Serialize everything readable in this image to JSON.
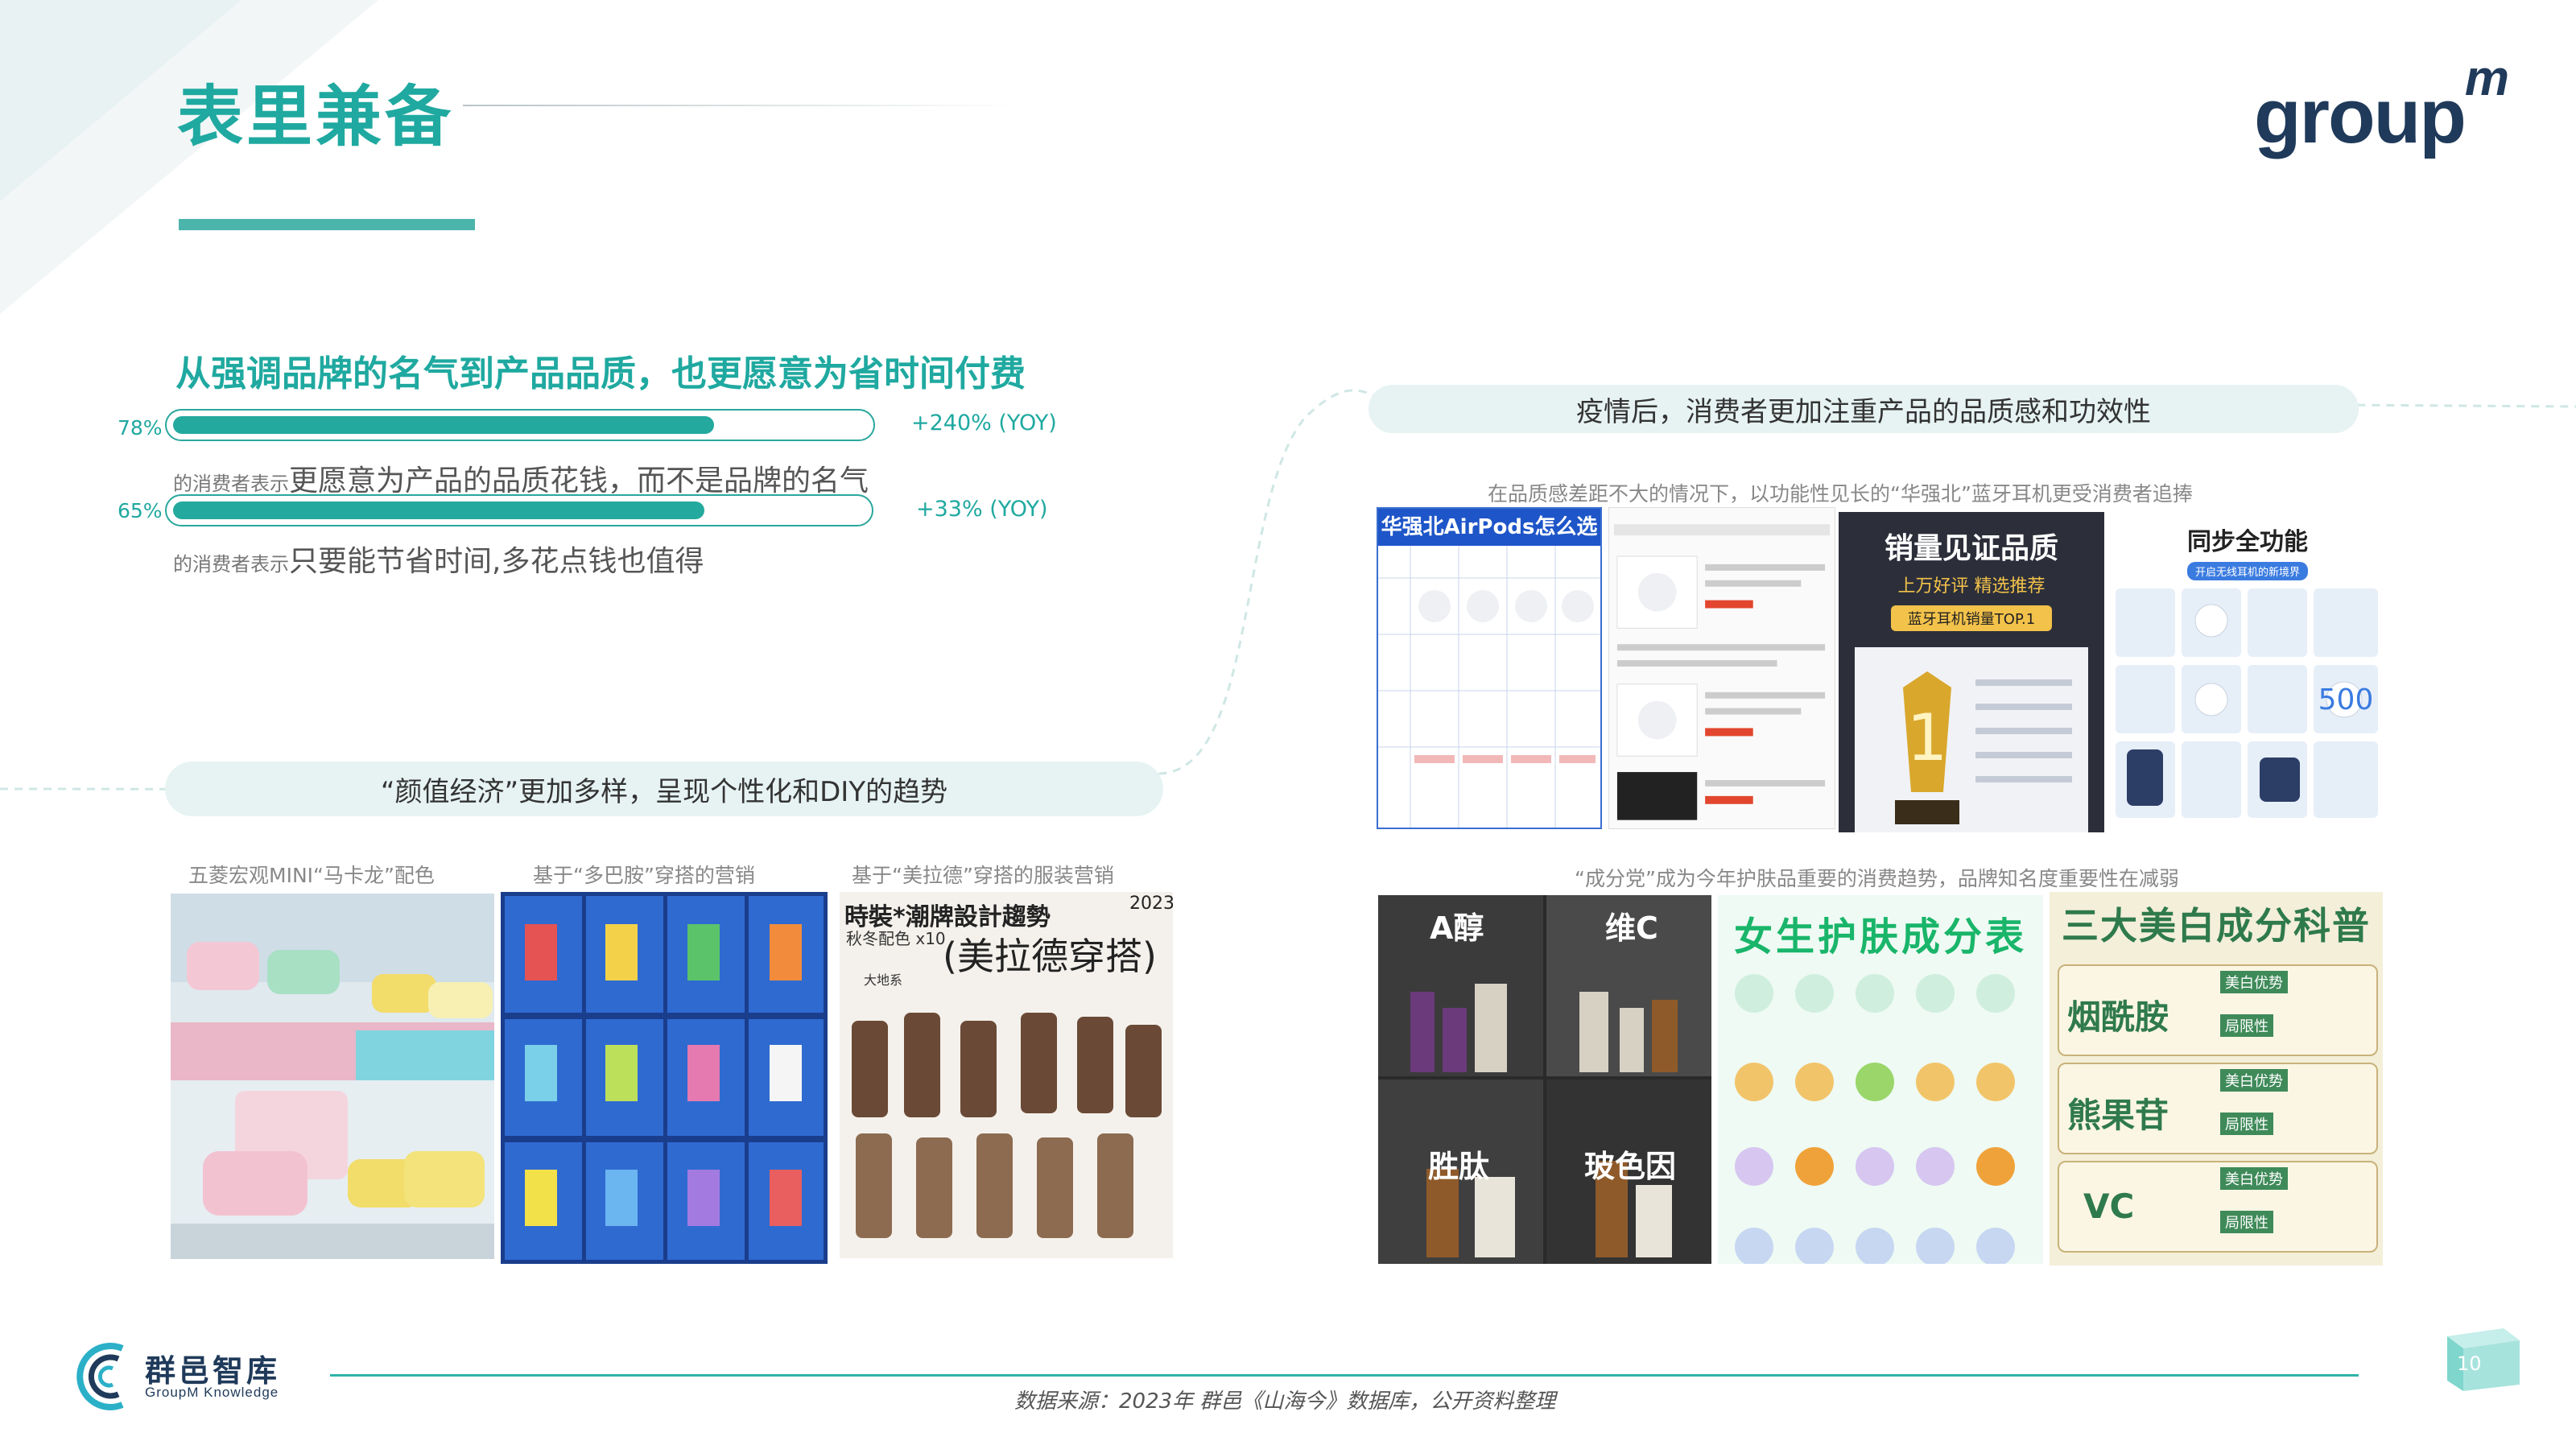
{
  "header": {
    "title": "表里兼备",
    "logo_text": "group",
    "logo_sup": "m",
    "accent": "#1fa9a0"
  },
  "left_section": {
    "headline": "从强调品牌的名气到产品品质，也更愿意为省时间付费",
    "stats": [
      {
        "percent": "78%",
        "fill": 0.78,
        "yoy": "+240% (YOY)",
        "prefix": "的消费者表示",
        "text": "更愿意为产品的品质花钱，而不是品牌的名气"
      },
      {
        "percent": "65%",
        "fill": 0.65,
        "yoy": "+33% (YOY)",
        "prefix": "的消费者表示",
        "text": "只要能节省时间,多花点钱也值得"
      }
    ],
    "pill": "“颜值经济”更加多样，呈现个性化和DIY的趋势",
    "captions": [
      "五菱宏观MINI“马卡龙”配色",
      "基于“多巴胺”穿搭的营销",
      "基于“美拉德”穿搭的服装营销"
    ],
    "fashion_poster": {
      "line1": "時裝*潮牌設計趨勢",
      "year": "2023",
      "sub": "秋冬配色 x10",
      "big": "(美拉德穿搭)",
      "tag": "大地系"
    }
  },
  "right_section": {
    "pill": "疫情后，消费者更加注重产品的品质感和功效性",
    "caption_top": "在品质感差距不大的情况下，以功能性见长的“华强北”蓝牙耳机更受消费者追捧",
    "caption_mid": "“成分党”成为今年护肤品重要的消费趋势，品牌知名度重要性在减弱",
    "earphone_panels": {
      "p1_title": "华强北AirPods怎么选",
      "p3_title": "销量见证品质",
      "p3_sub": "上万好评  精选推荐",
      "p3_badge": "蓝牙耳机销量TOP.1",
      "p4_title": "同步全功能",
      "p4_badge": "开启无线耳机的新境界"
    },
    "skincare_panels": {
      "labels": [
        "A醇",
        "维C",
        "胜肽",
        "玻色因"
      ],
      "chart_title": "女生护肤成分表",
      "ingredient_title": "三大美白成分科普",
      "ingredients": [
        "烟酰胺",
        "熊果苷",
        "VC"
      ],
      "tag1": "美白优势",
      "tag2": "局限性"
    }
  },
  "footer": {
    "source": "数据来源：2023年 群邑《山海今》数据库，公开资料整理",
    "brand_name": "群邑智库",
    "brand_sub": "GroupM Knowledge",
    "page": "10"
  }
}
